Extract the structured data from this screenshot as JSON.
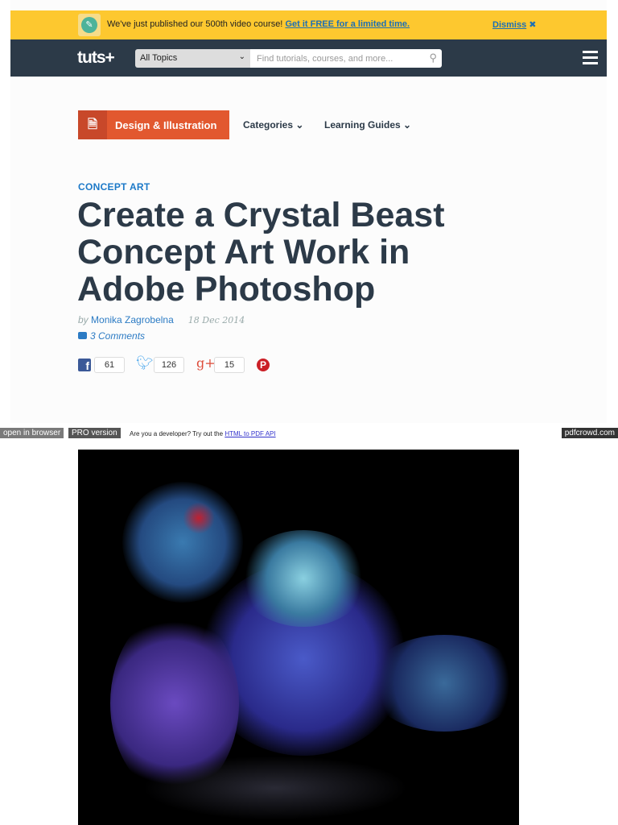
{
  "banner": {
    "message": "We've just published our 500th video course!",
    "link": "Get it FREE for a limited time.",
    "dismiss": "Dismiss",
    "dismiss_icon": "✖"
  },
  "nav": {
    "logo": "tuts+",
    "topic_select": "All Topics",
    "search_placeholder": "Find tutorials, courses, and more..."
  },
  "subnav": {
    "category": "Design & Illustration",
    "categories": "Categories",
    "guides": "Learning Guides"
  },
  "article": {
    "kicker": "CONCEPT ART",
    "title": "Create a Crystal Beast Concept Art Work in Adobe Photoshop",
    "by": "by",
    "author": "Monika Zagrobelna",
    "date": "18 Dec 2014",
    "comments": "3 Comments"
  },
  "share": {
    "facebook": "61",
    "twitter": "126",
    "googleplus": "15"
  },
  "pdfcrowd": {
    "open": "open in browser",
    "pro": "PRO version",
    "dev": "Are you a developer? Try out the",
    "api": "HTML to PDF API",
    "brand": "pdfcrowd.com"
  }
}
